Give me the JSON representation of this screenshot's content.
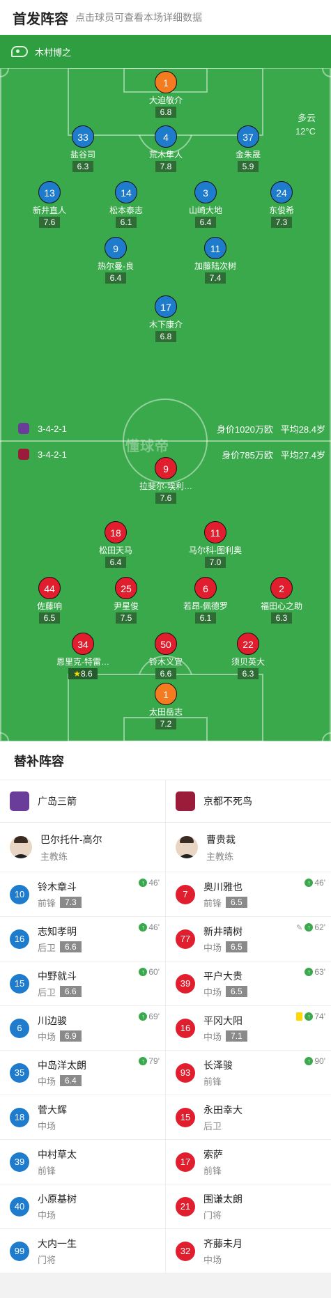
{
  "header": {
    "title": "首发阵容",
    "subtitle": "点击球员可查看本场详细数据"
  },
  "referee": "木村博之",
  "weather": {
    "condition": "多云",
    "temp": "12°C"
  },
  "watermark": "懂球帝",
  "home": {
    "name": "广岛三箭",
    "formation": "3-4-2-1",
    "value": "身价1020万欧",
    "avg_age": "平均28.4岁",
    "players": [
      {
        "num": "1",
        "name": "大迫敬介",
        "rating": "6.8",
        "gk": true,
        "captain": true,
        "row": 0,
        "col": 0.5
      },
      {
        "num": "33",
        "name": "盐谷司",
        "rating": "6.3",
        "row": 1,
        "col": 0.25
      },
      {
        "num": "4",
        "name": "荒木隼人",
        "rating": "7.8",
        "row": 1,
        "col": 0.5,
        "goal": true
      },
      {
        "num": "37",
        "name": "金朱晟",
        "rating": "5.9",
        "row": 1,
        "col": 0.75
      },
      {
        "num": "13",
        "name": "新井直人",
        "rating": "7.6",
        "row": 2,
        "col": 0.15,
        "out": "60'",
        "assist": true
      },
      {
        "num": "14",
        "name": "松本泰志",
        "rating": "6.1",
        "row": 2,
        "col": 0.38
      },
      {
        "num": "3",
        "name": "山崎大地",
        "rating": "6.4",
        "row": 2,
        "col": 0.62,
        "out": "79'"
      },
      {
        "num": "24",
        "name": "东俊希",
        "rating": "7.3",
        "row": 2,
        "col": 0.85,
        "out": "46'"
      },
      {
        "num": "9",
        "name": "热尔曼-良",
        "rating": "6.4",
        "row": 3,
        "col": 0.35,
        "out": "69'"
      },
      {
        "num": "11",
        "name": "加藤陆次树",
        "rating": "7.4",
        "row": 3,
        "col": 0.65
      },
      {
        "num": "17",
        "name": "木下康介",
        "rating": "6.8",
        "row": 4,
        "col": 0.5,
        "out": "46'"
      }
    ]
  },
  "away": {
    "name": "京都不死鸟",
    "formation": "3-4-2-1",
    "value": "身价785万欧",
    "avg_age": "平均27.4岁",
    "players": [
      {
        "num": "9",
        "name": "拉斐尔-埃利…",
        "rating": "7.6",
        "row": 0,
        "col": 0.5,
        "yellow": true,
        "goal": true
      },
      {
        "num": "18",
        "name": "松田天马",
        "rating": "6.4",
        "row": 1,
        "col": 0.35,
        "out": "46'"
      },
      {
        "num": "11",
        "name": "马尔科-图利奥",
        "rating": "7.0",
        "row": 1,
        "col": 0.65,
        "out": "90'",
        "assist": true
      },
      {
        "num": "44",
        "name": "佐藤响",
        "rating": "6.5",
        "row": 2,
        "col": 0.15,
        "out": "62'"
      },
      {
        "num": "25",
        "name": "尹星俊",
        "rating": "7.5",
        "row": 2,
        "col": 0.38,
        "out": "74'",
        "captain": true
      },
      {
        "num": "6",
        "name": "若昂-佩德罗",
        "rating": "6.1",
        "row": 2,
        "col": 0.62
      },
      {
        "num": "2",
        "name": "福田心之助",
        "rating": "6.3",
        "row": 2,
        "col": 0.85,
        "yellow": true
      },
      {
        "num": "34",
        "name": "恩里克-特雷…",
        "rating": "8.6",
        "row": 3,
        "col": 0.25,
        "yellow": true,
        "goal": true,
        "star": true
      },
      {
        "num": "50",
        "name": "铃木义宜",
        "rating": "6.6",
        "row": 3,
        "col": 0.5
      },
      {
        "num": "22",
        "name": "须贝英大",
        "rating": "6.3",
        "row": 3,
        "col": 0.75,
        "out": "63'",
        "yellow": true
      },
      {
        "num": "1",
        "name": "太田岳志",
        "rating": "7.2",
        "row": 4,
        "col": 0.5,
        "gk": true
      }
    ]
  },
  "bench_title": "替补阵容",
  "bench": {
    "home_coach": {
      "name": "巴尔托什-高尔",
      "role": "主教练"
    },
    "away_coach": {
      "name": "曹贵裁",
      "role": "主教练"
    },
    "home_subs": [
      {
        "num": "10",
        "name": "铃木章斗",
        "pos": "前锋",
        "rating": "7.3",
        "in": "46'"
      },
      {
        "num": "16",
        "name": "志知孝明",
        "pos": "后卫",
        "rating": "6.6",
        "in": "46'"
      },
      {
        "num": "15",
        "name": "中野就斗",
        "pos": "后卫",
        "rating": "6.6",
        "in": "60'"
      },
      {
        "num": "6",
        "name": "川边骏",
        "pos": "中场",
        "rating": "6.9",
        "in": "69'"
      },
      {
        "num": "35",
        "name": "中岛洋太朗",
        "pos": "中场",
        "rating": "6.4",
        "in": "79'"
      },
      {
        "num": "18",
        "name": "菅大辉",
        "pos": "中场"
      },
      {
        "num": "39",
        "name": "中村草太",
        "pos": "前锋"
      },
      {
        "num": "40",
        "name": "小原基树",
        "pos": "中场"
      },
      {
        "num": "99",
        "name": "大内一生",
        "pos": "门将"
      }
    ],
    "away_subs": [
      {
        "num": "7",
        "name": "奥川雅也",
        "pos": "前锋",
        "rating": "6.5",
        "in": "46'"
      },
      {
        "num": "77",
        "name": "新井晴树",
        "pos": "中场",
        "rating": "6.5",
        "in": "62'",
        "assist": true
      },
      {
        "num": "39",
        "name": "平户大贵",
        "pos": "中场",
        "rating": "6.5",
        "in": "63'"
      },
      {
        "num": "16",
        "name": "平冈大阳",
        "pos": "中场",
        "rating": "7.1",
        "in": "74'",
        "yellow": true
      },
      {
        "num": "93",
        "name": "长泽骏",
        "pos": "前锋",
        "in": "90'"
      },
      {
        "num": "15",
        "name": "永田幸大",
        "pos": "后卫"
      },
      {
        "num": "17",
        "name": "索萨",
        "pos": "前锋"
      },
      {
        "num": "21",
        "name": "围谦太朗",
        "pos": "门将"
      },
      {
        "num": "32",
        "name": "齐藤未月",
        "pos": "中场"
      }
    ]
  }
}
